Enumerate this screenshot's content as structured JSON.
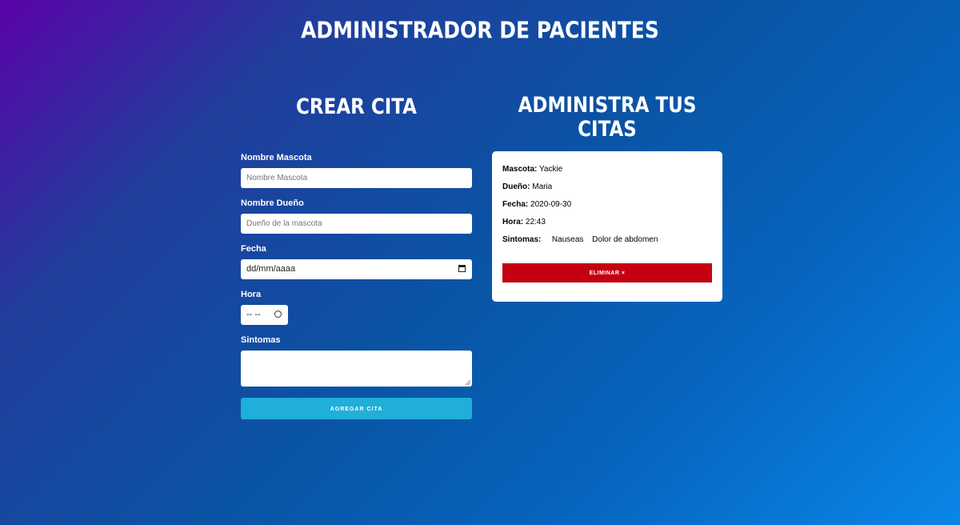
{
  "header": {
    "title": "ADMINISTRADOR DE PACIENTES"
  },
  "form_section": {
    "heading": "CREAR CITA",
    "fields": {
      "mascota": {
        "label": "Nombre Mascota",
        "placeholder": "Nombre Mascota"
      },
      "dueno": {
        "label": "Nombre Dueño",
        "placeholder": "Dueño de la mascota"
      },
      "fecha": {
        "label": "Fecha",
        "value": "dd/mm/aaaa"
      },
      "hora": {
        "label": "Hora",
        "value": "-- --"
      },
      "sintomas": {
        "label": "Sintomas",
        "value": ""
      }
    },
    "submit_label": "AGREGAR CITA"
  },
  "list_section": {
    "heading": "ADMINISTRA TUS CITAS",
    "appointments": [
      {
        "mascota_label": "Mascota:",
        "mascota": "Yackie",
        "dueno_label": "Dueño:",
        "dueno": "Maria",
        "fecha_label": "Fecha:",
        "fecha": "2020-09-30",
        "hora_label": "Hora:",
        "hora": "22:43",
        "sintomas_label": "Sintomas:",
        "sintomas": [
          "Nauseas",
          "Dolor de abdomen"
        ],
        "delete_label": "ELIMINAR ×"
      }
    ]
  },
  "colors": {
    "submit_button": "#1fafd9",
    "delete_button": "#c40011",
    "gradient_start": "#5a02a8",
    "gradient_end": "#0a86e8"
  },
  "icons": [
    "calendar-icon",
    "clock-icon",
    "resize-grip-icon"
  ]
}
